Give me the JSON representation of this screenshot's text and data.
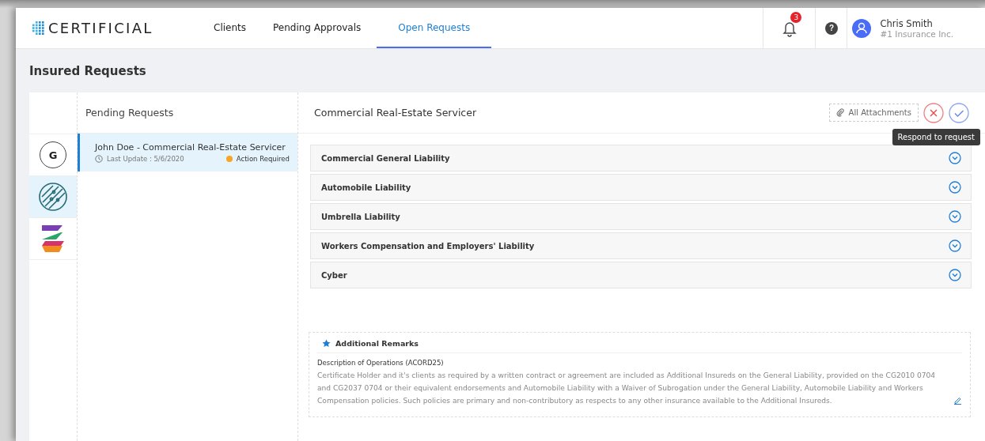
{
  "header": {
    "brand": "CERTIFICIAL",
    "nav": [
      {
        "label": "Clients",
        "selected": false
      },
      {
        "label": "Pending Approvals",
        "selected": false
      },
      {
        "label": "Open Requests",
        "selected": true
      }
    ],
    "notifications": {
      "count": "3"
    },
    "help": "?",
    "user": {
      "name": "Chris Smith",
      "company": "#1 Insurance Inc."
    }
  },
  "page_title": "Insured Requests",
  "clients": [
    {
      "kind": "letter",
      "mark": "G",
      "selected": false
    },
    {
      "kind": "circuit",
      "selected": true
    },
    {
      "kind": "stripes",
      "selected": false
    }
  ],
  "pending": {
    "title": "Pending Requests",
    "requests": [
      {
        "title": "John Doe - Commercial Real-Estate Servicer",
        "updated": "Last Update : 5/6/2020",
        "status": "Action Required",
        "color": "#f5a623",
        "selected": true
      }
    ]
  },
  "detail": {
    "title": "Commercial Real-Estate Servicer",
    "attachments": "All Attachments",
    "tooltip": "Respond to request",
    "sections": [
      {
        "title": "Commercial General Liability",
        "expanded": false
      },
      {
        "title": "Automobile Liability",
        "expanded": false
      },
      {
        "title": "Umbrella Liability",
        "expanded": false
      },
      {
        "title": "Workers Compensation and Employers' Liability",
        "expanded": false
      },
      {
        "title": "Cyber",
        "expanded": false
      }
    ],
    "remarks": {
      "title": "Additional Remarks",
      "subtitle": "Description of Operations (ACORD25)",
      "text": "Certificate Holder and it's clients as required by a written contract or agreement are included as Additional Insureds on the General Liability, provided on the CG2010 0704 and CG2037 0704 or their equivalent endorsements and Automobile Liability with a Waiver of Subrogation under the General Liability, Automobile Liability and Workers Compensation policies. Such policies are primary and non-contributory as respects to any other insurance available to the Additional Insureds."
    }
  }
}
